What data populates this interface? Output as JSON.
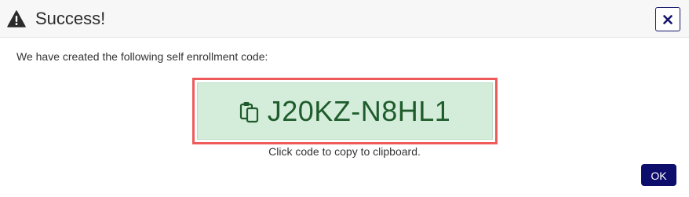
{
  "dialog": {
    "title": "Success!",
    "message": "We have created the following self enrollment code:",
    "code": "J20KZ-N8HL1",
    "hint": "Click code to copy to clipboard.",
    "ok_label": "OK",
    "icons": {
      "title_icon": "warning-triangle-icon",
      "close_icon": "close-icon",
      "code_icon": "clipboard-icon"
    },
    "colors": {
      "header_bg": "#f7f7f7",
      "primary": "#0d0d6b",
      "code_bg": "#d4edda",
      "code_text": "#1f5c2c",
      "highlight_border": "#ef5b5b"
    }
  }
}
